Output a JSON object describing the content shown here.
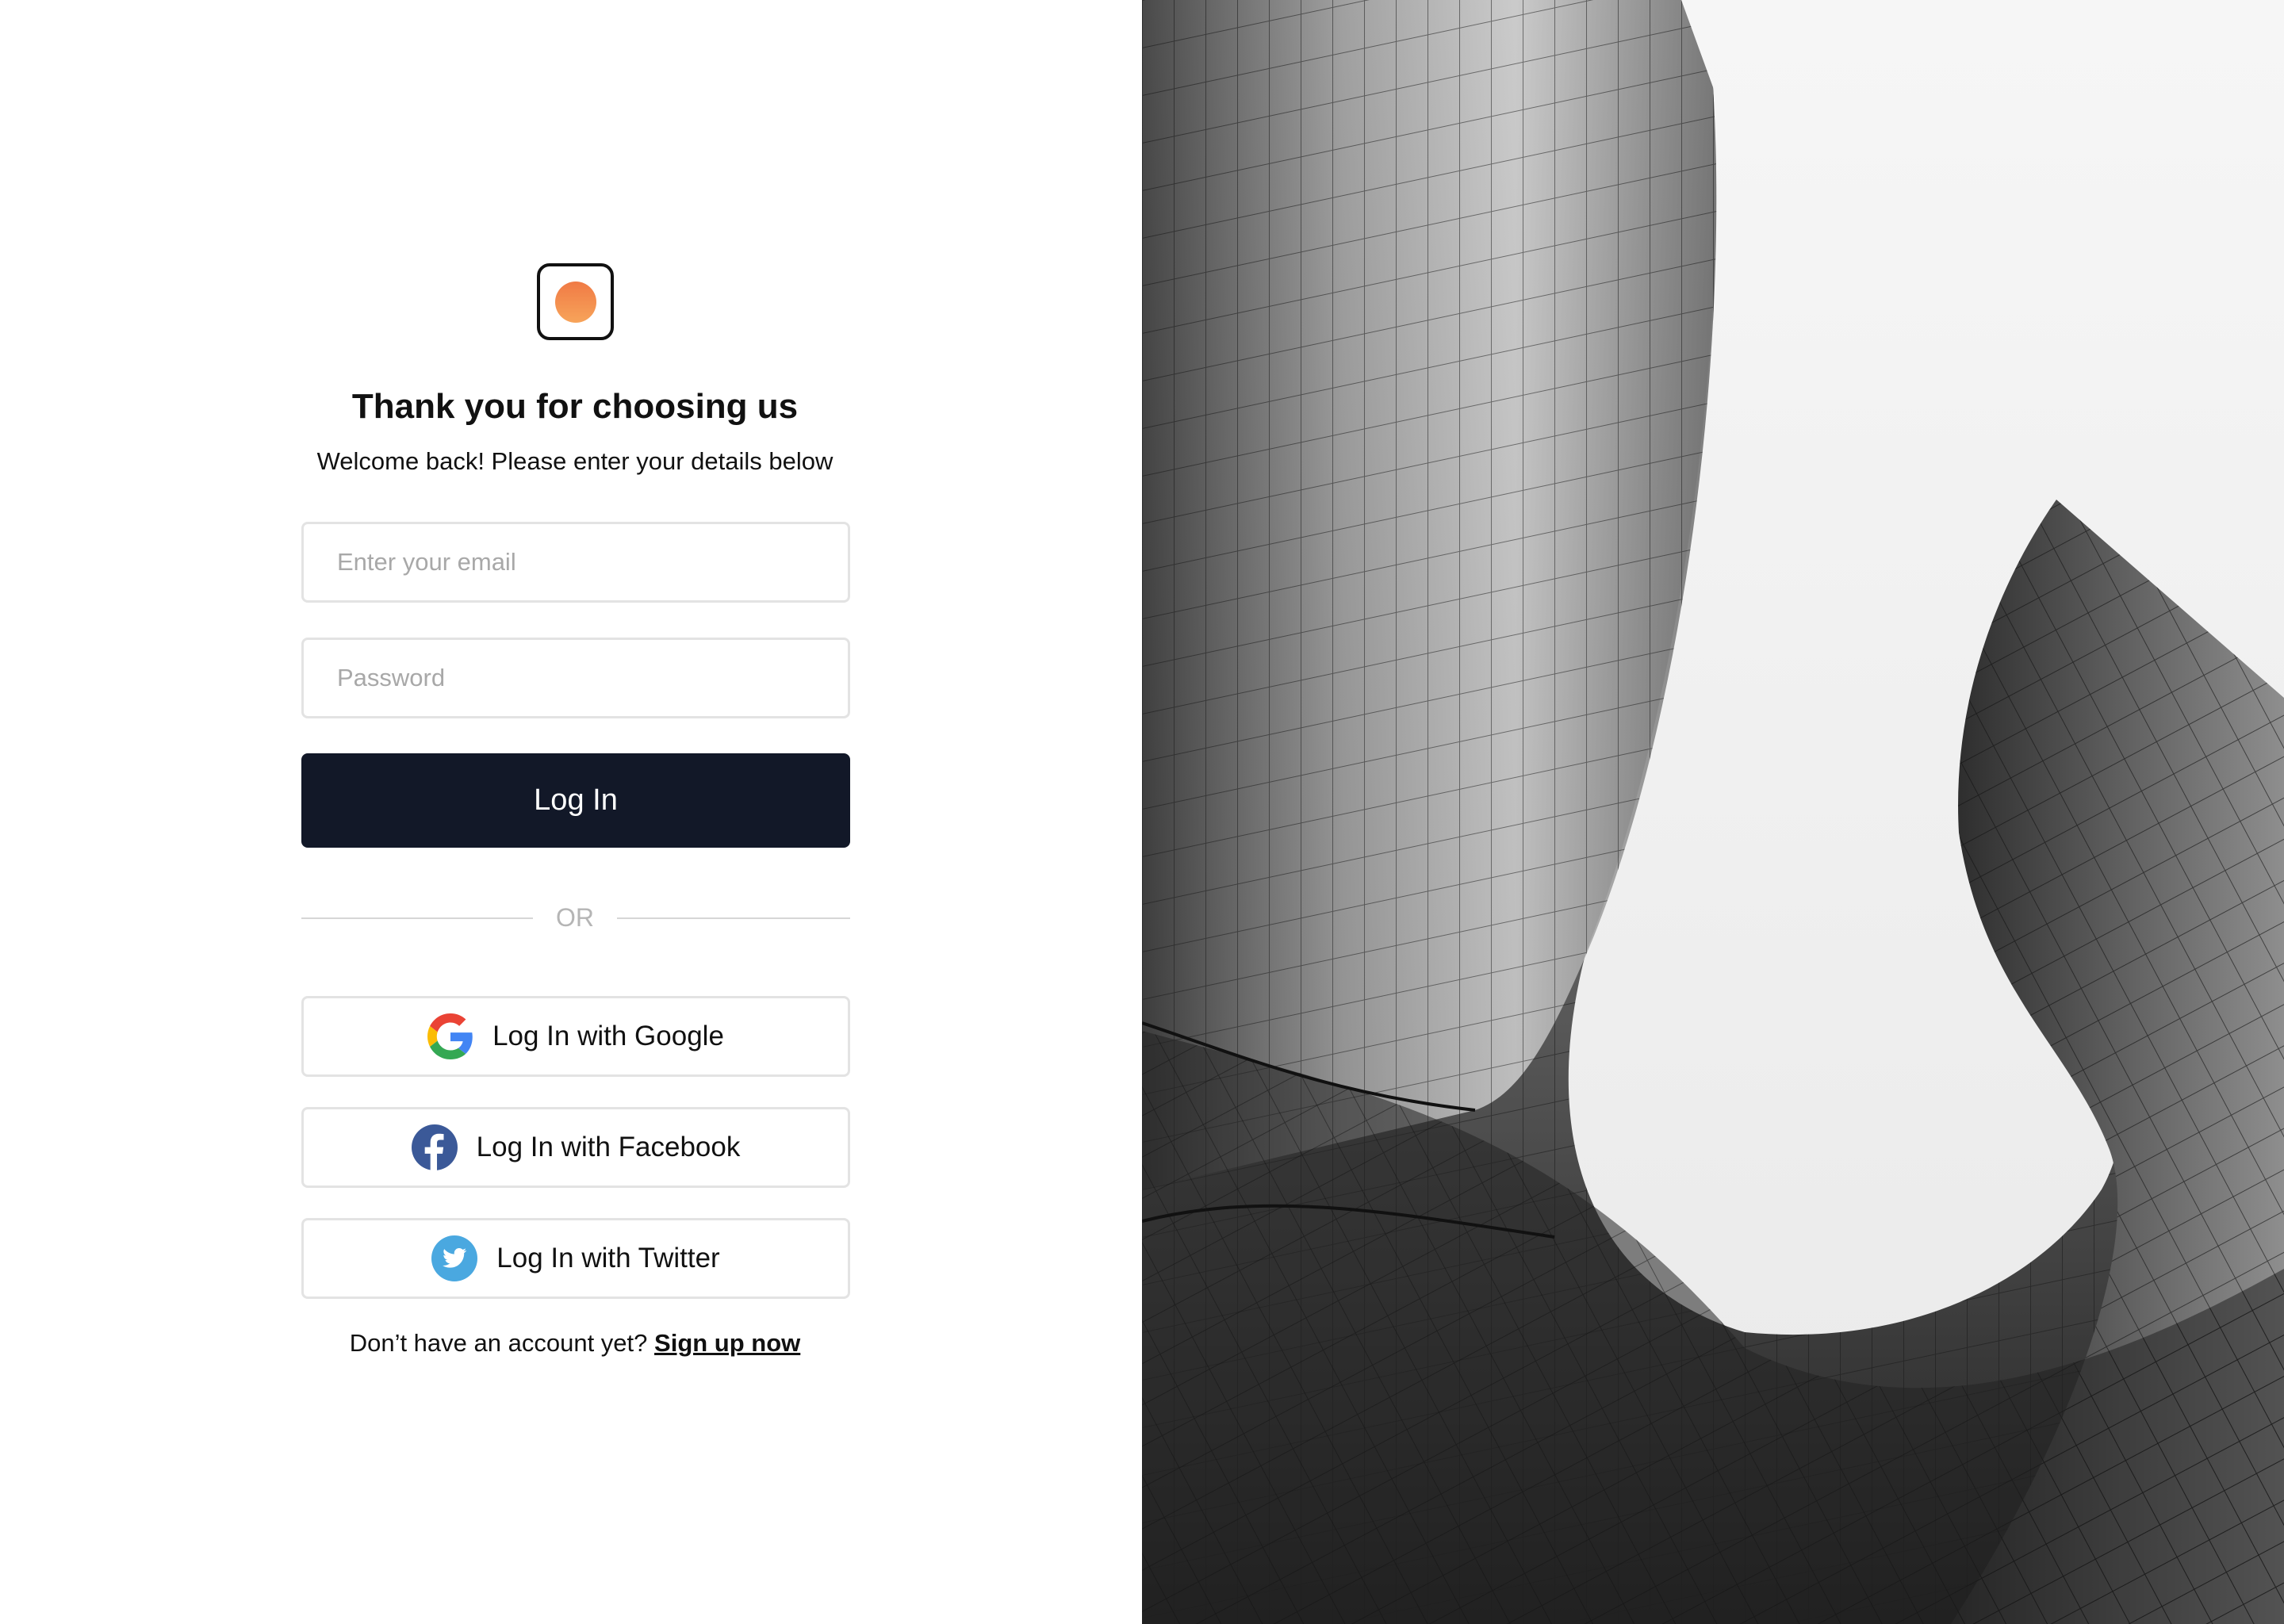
{
  "header": {
    "title": "Thank you for choosing us",
    "subtitle": "Welcome back! Please enter your details below"
  },
  "form": {
    "email_placeholder": "Enter your email",
    "password_placeholder": "Password",
    "login_label": "Log In"
  },
  "divider": {
    "label": "OR"
  },
  "social": {
    "google_label": "Log In with Google",
    "facebook_label": "Log In with Facebook",
    "twitter_label": "Log In with Twitter"
  },
  "footer": {
    "prompt": "Don’t have an account yet?",
    "signup_label": "Sign up now"
  },
  "colors": {
    "primary_button": "#121828",
    "logo_gradient_top": "#f07a45",
    "logo_gradient_bottom": "#f7a45a",
    "facebook": "#3b5998",
    "twitter": "#4aa8e0"
  },
  "icons": {
    "logo": "logo-icon",
    "google": "google-icon",
    "facebook": "facebook-icon",
    "twitter": "twitter-icon"
  }
}
